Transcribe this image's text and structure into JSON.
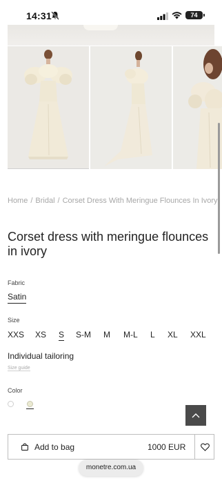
{
  "status_bar": {
    "time": "14:31",
    "battery": "74"
  },
  "breadcrumb": {
    "items": [
      "Home",
      "Bridal",
      "Corset Dress With Meringue Flounces In Ivory"
    ],
    "separator": "/"
  },
  "product": {
    "title": "Corset dress with meringue flounces in ivory",
    "fabric_label": "Fabric",
    "fabric_value": "Satin",
    "size_label": "Size",
    "sizes": [
      "XXS",
      "XS",
      "S",
      "S-M",
      "M",
      "M-L",
      "L",
      "XL",
      "XXL"
    ],
    "selected_size": "S",
    "tailoring": "Individual tailoring",
    "size_guide": "Size guide",
    "color_label": "Color",
    "colors": [
      "#ffffff",
      "#ebead2"
    ],
    "selected_color": "#ebead2"
  },
  "bag": {
    "label": "Add to bag",
    "price": "1000 EUR"
  },
  "browser": {
    "url": "monetre.com.ua"
  },
  "icons": [
    "bell-slash-icon",
    "signal-icon",
    "wifi-icon",
    "chevron-up-icon",
    "shopping-bag-icon",
    "heart-icon"
  ]
}
